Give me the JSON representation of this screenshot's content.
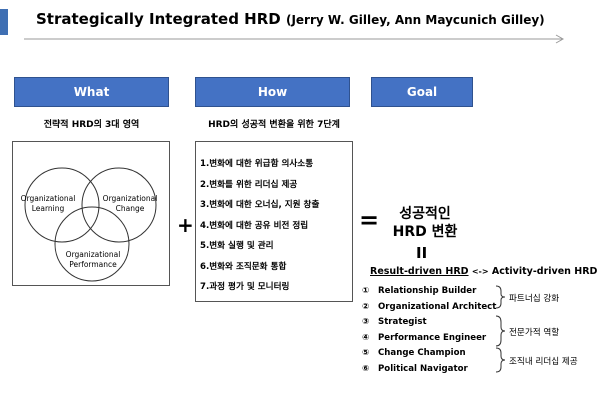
{
  "title": {
    "main": "Strategically Integrated HRD",
    "authors": "(Jerry W. Gilley, Ann Maycunich  Gilley)"
  },
  "headers": {
    "what": "What",
    "how": "How",
    "goal": "Goal"
  },
  "captions": {
    "what": "전략적 HRD의 3대 영역",
    "how": "HRD의 성공적 변환을 위한 7단계"
  },
  "venn": {
    "circle1": "Organizational Learning",
    "circle2": "Organizational Change",
    "circle3": "Organizational Performance"
  },
  "steps": [
    "1.변화에 대한 위급함 의사소통",
    "2.변화를 위한 리더십 제공",
    "3.변화에 대한 오너십, 지원 창출",
    "4.변화에 대한 공유 비전 정립",
    "5.변화 실행 및 관리",
    "6.변화와 조직문화 통합",
    "7.과정 평가 및 모니터링"
  ],
  "operators": {
    "plus": "+",
    "equals": "=",
    "double": "II"
  },
  "goal": {
    "line1": "성공적인",
    "line2": "HRD 변환",
    "result_driven": "Result-driven HRD",
    "arrow": "<->",
    "activity_driven": "Activity-driven HRD"
  },
  "roles": [
    {
      "num": "①",
      "name": "Relationship Builder"
    },
    {
      "num": "②",
      "name": "Organizational Architect"
    },
    {
      "num": "③",
      "name": "Strategist"
    },
    {
      "num": "④",
      "name": "Performance Engineer"
    },
    {
      "num": "⑤",
      "name": "Change Champion"
    },
    {
      "num": "⑥",
      "name": "Political Navigator"
    }
  ],
  "groups": {
    "g1": "파트너십 강화",
    "g2": "전문가적 역할",
    "g3": "조직내 리더십 제공"
  }
}
